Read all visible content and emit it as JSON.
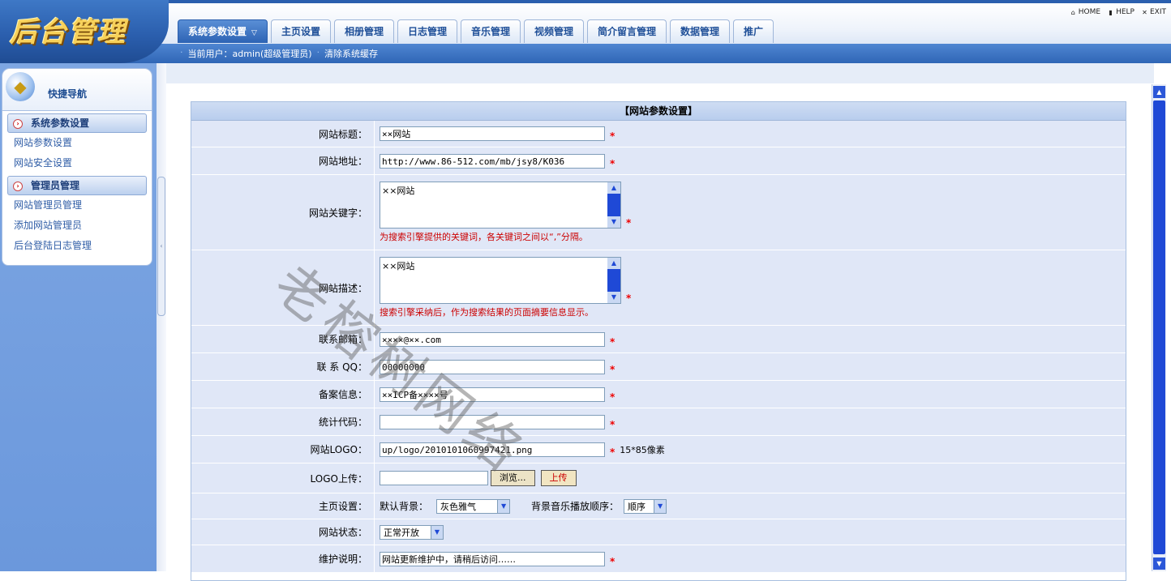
{
  "app": {
    "logo_text": "后台管理"
  },
  "tabs": [
    {
      "label": "系统参数设置",
      "active": true,
      "caret": "▽"
    },
    {
      "label": "主页设置"
    },
    {
      "label": "相册管理"
    },
    {
      "label": "日志管理"
    },
    {
      "label": "音乐管理"
    },
    {
      "label": "视频管理"
    },
    {
      "label": "简介留言管理"
    },
    {
      "label": "数据管理"
    },
    {
      "label": "推广"
    }
  ],
  "toplinks": [
    {
      "label": "HOME",
      "icon": "home-icon"
    },
    {
      "label": "HELP",
      "icon": "help-icon"
    },
    {
      "label": "EXIT",
      "icon": "close-icon"
    }
  ],
  "subbar": {
    "current_user": "当前用户：admin(超级管理员)",
    "clear_cache": "清除系统缓存"
  },
  "sidebar": {
    "title": "快捷导航",
    "groups": [
      {
        "label": "系统参数设置",
        "items": [
          "网站参数设置",
          "网站安全设置"
        ]
      },
      {
        "label": "管理员管理",
        "items": [
          "网站管理员管理",
          "添加网站管理员",
          "后台登陆日志管理"
        ]
      }
    ]
  },
  "form": {
    "title": "【网站参数设置】",
    "site_title": {
      "label": "网站标题：",
      "value": "××网站"
    },
    "site_url": {
      "label": "网站地址：",
      "value": "http://www.86-512.com/mb/jsy8/K036"
    },
    "keywords": {
      "label": "网站关键字：",
      "value": "××网站",
      "hint": "为搜索引擎提供的关键词，各关键词之间以“,”分隔。"
    },
    "description": {
      "label": "网站描述：",
      "value": "××网站",
      "hint": "搜索引擎采纳后，作为搜索结果的页面摘要信息显示。"
    },
    "email": {
      "label": "联系邮箱：",
      "value": "××××@××.com"
    },
    "qq": {
      "label": "联 系 QQ：",
      "value": "00000000"
    },
    "icp": {
      "label": "备案信息：",
      "value": "××ICP备××××号"
    },
    "stats_code": {
      "label": "统计代码：",
      "value": ""
    },
    "logo": {
      "label": "网站LOGO：",
      "value": "up/logo/2010101060997421.png",
      "note": "15*85像素"
    },
    "logo_upload": {
      "label": "LOGO上传：",
      "browse": "浏览...",
      "upload": "上传"
    },
    "home_settings": {
      "label": "主页设置：",
      "bg_label": "默认背景：",
      "bg_value": "灰色雅气",
      "music_label": "背景音乐播放顺序：",
      "music_value": "顺序"
    },
    "site_status": {
      "label": "网站状态：",
      "value": "正常开放"
    },
    "maintenance": {
      "label": "维护说明：",
      "value": "网站更新维护中，请稍后访问……"
    },
    "required_mark": "*"
  },
  "watermark": "老榕树网络"
}
